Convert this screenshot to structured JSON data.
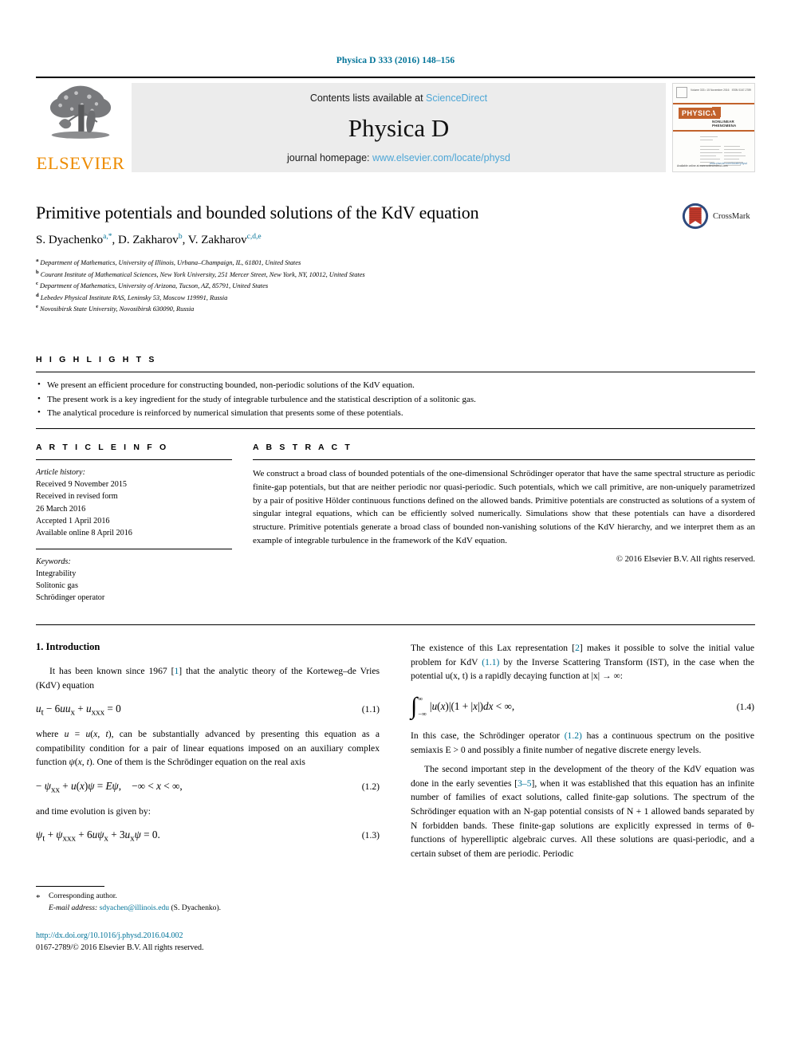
{
  "running_head": "Physica D 333 (2016) 148–156",
  "masthead": {
    "publisher_wordmark": "ELSEVIER",
    "contents_prefix": "Contents lists available at ",
    "contents_link": "ScienceDirect",
    "journal_title": "Physica D",
    "homepage_prefix": "journal homepage: ",
    "homepage_link": "www.elsevier.com/locate/physd",
    "cover": {
      "badge": "PHYSICA",
      "letter": "D",
      "subtitle": "NONLINEAR PHENOMENA",
      "top_left": "Volume 333 • 15 November 2016",
      "top_right": "ISSN 0167-2789",
      "footer_left": "Available online at www.sciencedirect.com",
      "footer_right": "www.elsevier.com/locate/physd"
    }
  },
  "article": {
    "title": "Primitive potentials and bounded solutions of the KdV equation",
    "authors": [
      {
        "name": "S. Dyachenko",
        "marks": "a,*"
      },
      {
        "name": "D. Zakharov",
        "marks": "b"
      },
      {
        "name": "V. Zakharov",
        "marks": "c,d,e"
      }
    ],
    "authors_line": "S. Dyachenko a,*, D. Zakharov b, V. Zakharov c,d,e",
    "affiliations": [
      {
        "label": "a",
        "text": "Department of Mathematics, University of Illinois, Urbana–Champaign, IL, 61801, United States"
      },
      {
        "label": "b",
        "text": "Courant Institute of Mathematical Sciences, New York University, 251 Mercer Street, New York, NY, 10012, United States"
      },
      {
        "label": "c",
        "text": "Department of Mathematics, University of Arizona, Tucson, AZ, 85791, United States"
      },
      {
        "label": "d",
        "text": "Lebedev Physical Institute RAS, Leninsky 53, Moscow 119991, Russia"
      },
      {
        "label": "e",
        "text": "Novosibirsk State University, Novosibirsk 630090, Russia"
      }
    ],
    "crossmark_label": "CrossMark"
  },
  "highlights": {
    "heading": "H I G H L I G H T S",
    "items": [
      "We present an efficient procedure for constructing bounded, non-periodic solutions of the KdV equation.",
      "The present work is a key ingredient for the study of integrable turbulence and the statistical description of a solitonic gas.",
      "The analytical procedure is reinforced by numerical simulation that presents some of these potentials."
    ]
  },
  "article_info": {
    "heading": "A R T I C L E    I N F O",
    "history_label": "Article history:",
    "history": [
      "Received 9 November 2015",
      "Received in revised form",
      "26 March 2016",
      "Accepted 1 April 2016",
      "Available online 8 April 2016"
    ],
    "keywords_label": "Keywords:",
    "keywords": [
      "Integrability",
      "Solitonic gas",
      "Schrödinger operator"
    ]
  },
  "abstract": {
    "heading": "A B S T R A C T",
    "text": "We construct a broad class of bounded potentials of the one-dimensional Schrödinger operator that have the same spectral structure as periodic finite-gap potentials, but that are neither periodic nor quasi-periodic. Such potentials, which we call primitive, are non-uniquely parametrized by a pair of positive Hölder continuous functions defined on the allowed bands. Primitive potentials are constructed as solutions of a system of singular integral equations, which can be efficiently solved numerically. Simulations show that these potentials can have a disordered structure. Primitive potentials generate a broad class of bounded non-vanishing solutions of the KdV hierarchy, and we interpret them as an example of integrable turbulence in the framework of the KdV equation.",
    "copyright": "© 2016 Elsevier B.V. All rights reserved."
  },
  "body": {
    "section_number_title": "1. Introduction",
    "left": {
      "p1_a": "It has been known since 1967 [",
      "p1_ref": "1",
      "p1_b": "] that the analytic theory of the Korteweg–de Vries (KdV) equation",
      "eq11_body": "u_t − 6uu_x + u_xxx = 0",
      "eq11_num": "(1.1)",
      "p2": "where u = u(x, t), can be substantially advanced by presenting this equation as a compatibility condition for a pair of linear equations imposed on an auxiliary complex function ψ(x, t). One of them is the Schrödinger equation on the real axis",
      "eq12_body": "− ψ_xx + u(x)ψ = Eψ,    −∞ < x < ∞,",
      "eq12_num": "(1.2)",
      "p3": "and time evolution is given by:",
      "eq13_body": "ψ_t + ψ_xxx + 6uψ_x + 3u_xψ = 0.",
      "eq13_num": "(1.3)"
    },
    "right": {
      "p1_a": "The existence of this Lax representation [",
      "p1_ref1": "2",
      "p1_b": "] makes it possible to solve the initial value problem for KdV ",
      "p1_ref2": "(1.1)",
      "p1_c": " by the Inverse Scattering Transform (IST), in the case when the potential u(x, t) is a rapidly decaying function at |x| → ∞:",
      "eq14_body": "|u(x)|(1 + |x|)dx < ∞,",
      "eq14_upper": "∞",
      "eq14_lower": "−∞",
      "eq14_num": "(1.4)",
      "p2_a": "In this case, the Schrödinger operator ",
      "p2_ref": "(1.2)",
      "p2_b": " has a continuous spectrum on the positive semiaxis E > 0 and possibly a finite number of negative discrete energy levels.",
      "p3_a": "The second important step in the development of the theory of the KdV equation was done in the early seventies [",
      "p3_ref": "3–5",
      "p3_b": "], when it was established that this equation has an infinite number of families of exact solutions, called finite-gap solutions. The spectrum of the Schrödinger equation with an N-gap potential consists of N + 1 allowed bands separated by N forbidden bands. These finite-gap solutions are explicitly expressed in terms of θ-functions of hyperelliptic algebraic curves. All these solutions are quasi-periodic, and a certain subset of them are periodic. Periodic"
    }
  },
  "footnote": {
    "corresponding": "Corresponding author.",
    "email_label": "E-mail address:",
    "email": "sdyachen@illinois.edu",
    "email_suffix": " (S. Dyachenko)."
  },
  "imprint": {
    "doi": "http://dx.doi.org/10.1016/j.physd.2016.04.002",
    "issn_line": "0167-2789/© 2016 Elsevier B.V. All rights reserved."
  },
  "colors": {
    "link": "#007398",
    "elsevier_orange": "#ED8B00",
    "masthead_bg": "#ececec",
    "sciencedirect_blue": "#4da6d6",
    "crossmark_blue": "#2e4a7d",
    "crossmark_red": "#c0392b"
  }
}
